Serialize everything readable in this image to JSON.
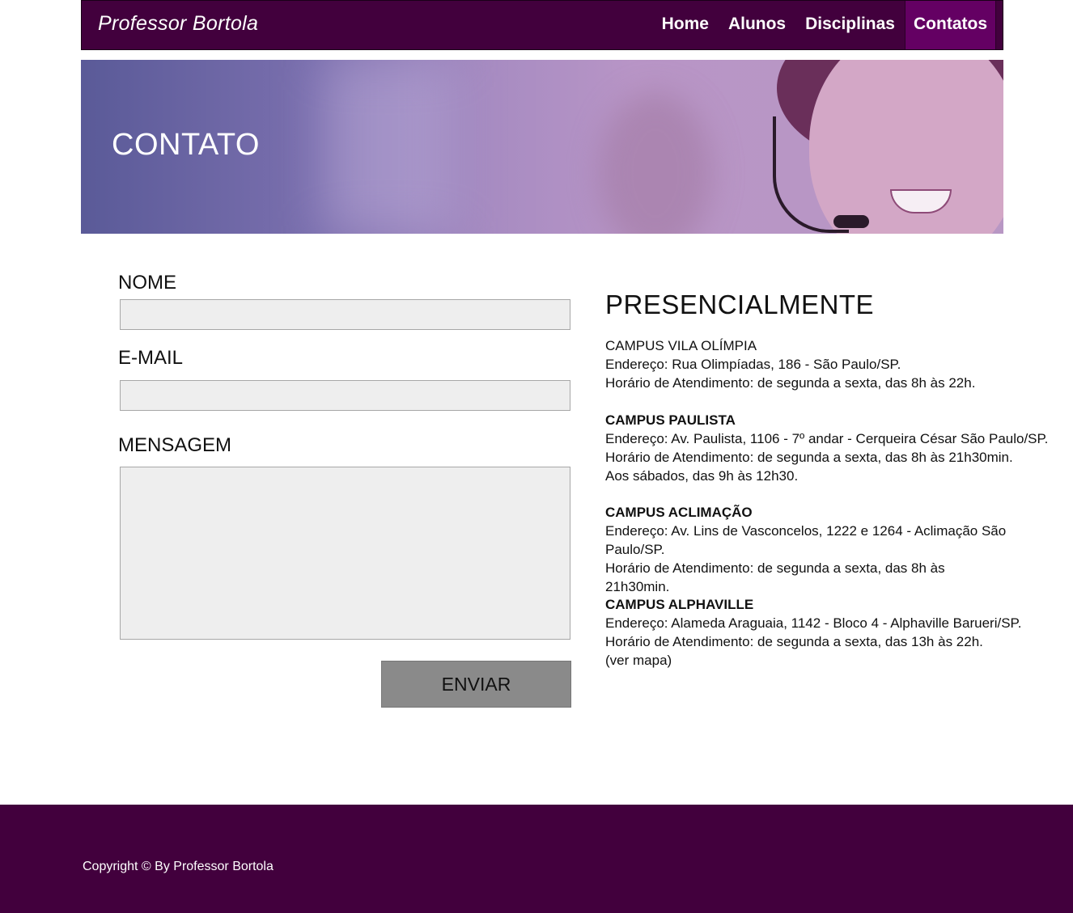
{
  "header": {
    "brand": "Professor Bortola",
    "nav": [
      "Home",
      "Alunos",
      "Disciplinas",
      "Contatos"
    ],
    "active": "Contatos",
    "color": "#42003d",
    "active_color": "#640063"
  },
  "banner": {
    "title": "CONTATO"
  },
  "form": {
    "name_label": "NOME",
    "email_label": "E-MAIL",
    "message_label": "MENSAGEM",
    "name_value": "",
    "email_value": "",
    "message_value": "",
    "submit_label": "ENVIAR"
  },
  "info": {
    "title": "PRESENCIALMENTE",
    "campuses": [
      {
        "name": "CAMPUS VILA OLÍMPIA",
        "lines": [
          "Endereço: Rua Olimpíadas, 186 - São Paulo/SP.",
          "Horário de Atendimento: de segunda a sexta, das 8h às 22h."
        ]
      },
      {
        "name": "CAMPUS PAULISTA",
        "lines": [
          "Endereço: Av. Paulista, 1106 - 7º andar - Cerqueira César São Paulo/SP.",
          "Horário de Atendimento: de segunda a sexta, das 8h às 21h30min.",
          "Aos sábados, das 9h às 12h30."
        ]
      },
      {
        "name": "CAMPUS ACLIMAÇÃO",
        "lines": [
          "Endereço: Av. Lins de Vasconcelos, 1222 e 1264 - Aclimação São Paulo/SP.",
          "Horário de Atendimento: de segunda a sexta, das 8h às 21h30min."
        ]
      },
      {
        "name": "CAMPUS ALPHAVILLE",
        "lines": [
          "Endereço: Alameda Araguaia, 1142 - Bloco 4 - Alphaville Barueri/SP.",
          "Horário de Atendimento: de segunda a sexta, das 13h às 22h.",
          "(ver mapa)"
        ]
      }
    ]
  },
  "footer": {
    "copyright": "Copyright © By Professor Bortola"
  }
}
